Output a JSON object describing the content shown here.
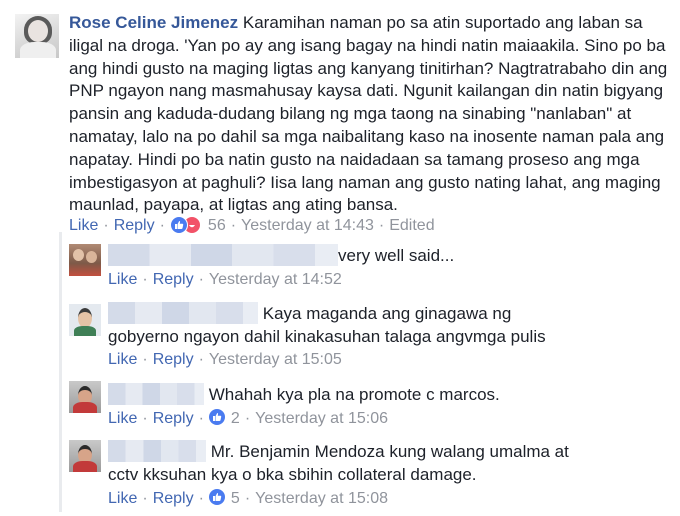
{
  "main_comment": {
    "author": "Rose Celine Jimenez",
    "text": "Karamihan naman po sa atin suportado ang laban sa iligal na droga. 'Yan po ay ang isang bagay na hindi natin maiaakila. Sino po ba ang hindi gusto na maging ligtas ang kanyang tinitirhan? Nagtratrabaho din ang PNP ngayon nang masmahusay kaysa dati. Ngunit kailangan din natin bigyang pansin ang kaduda-dudang bilang ng mga taong na sinabing \"nanlaban\" at namatay, lalo na po dahil sa mga naibalitang kaso na inosente naman pala ang napatay. Hindi po ba natin gusto na naidadaan sa tamang proseso ang mga imbestigasyon at paghuli? Iisa lang naman ang gusto nating lahat, ang maging maunlad, payapa, at ligtas ang ating bansa.",
    "like_label": "Like",
    "reply_label": "Reply",
    "reaction_count": "56",
    "timestamp": "Yesterday at 14:43",
    "edited_label": "Edited"
  },
  "replies": [
    {
      "text": "very well said...",
      "like_label": "Like",
      "reply_label": "Reply",
      "reaction_count": "",
      "timestamp": "Yesterday at 14:52"
    },
    {
      "text": "Kaya maganda ang ginagawa ng gobyerno ngayon dahil kinakasuhan talaga angvmga pulis",
      "like_label": "Like",
      "reply_label": "Reply",
      "reaction_count": "",
      "timestamp": "Yesterday at 15:05"
    },
    {
      "text": "Whahah kya pla na promote c marcos.",
      "like_label": "Like",
      "reply_label": "Reply",
      "reaction_count": "2",
      "timestamp": "Yesterday at 15:06"
    },
    {
      "text": "Mr. Benjamin Mendoza kung walang umalma at cctv kksuhan kya o bka sbihin collateral damage.",
      "like_label": "Like",
      "reply_label": "Reply",
      "reaction_count": "5",
      "timestamp": "Yesterday at 15:08"
    }
  ],
  "colors": {
    "link": "#4267b2",
    "author": "#365899",
    "meta": "#90949c",
    "like_icon": "#4a7bf0",
    "haha_icon": "#f25268"
  }
}
